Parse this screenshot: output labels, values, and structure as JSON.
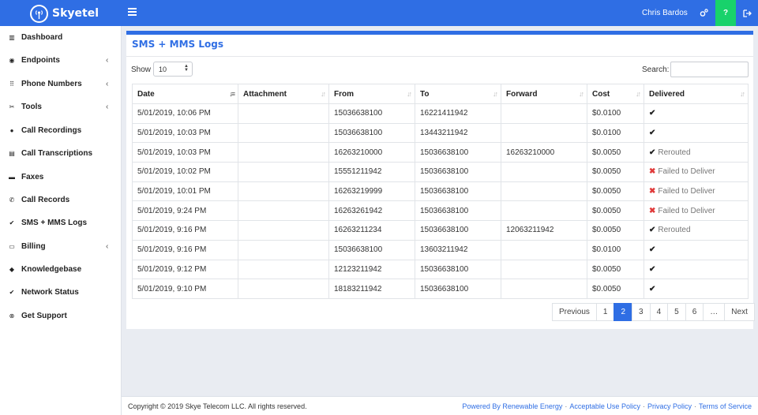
{
  "header": {
    "brand": "Skyetel",
    "user": "Chris Bardos",
    "help_label": "?"
  },
  "sidebar": {
    "items": [
      {
        "label": "Dashboard",
        "icon": "bar-chart-icon",
        "glyph": "▥",
        "chevron": ""
      },
      {
        "label": "Endpoints",
        "icon": "target-icon",
        "glyph": "◉",
        "chevron": "‹"
      },
      {
        "label": "Phone Numbers",
        "icon": "keypad-icon",
        "glyph": "⠿",
        "chevron": "‹"
      },
      {
        "label": "Tools",
        "icon": "tools-icon",
        "glyph": "✂",
        "chevron": "‹"
      },
      {
        "label": "Call Recordings",
        "icon": "microphone-icon",
        "glyph": "●",
        "chevron": ""
      },
      {
        "label": "Call Transcriptions",
        "icon": "document-icon",
        "glyph": "▤",
        "chevron": ""
      },
      {
        "label": "Faxes",
        "icon": "fax-icon",
        "glyph": "▬",
        "chevron": ""
      },
      {
        "label": "Call Records",
        "icon": "phone-icon",
        "glyph": "✆",
        "chevron": ""
      },
      {
        "label": "SMS + MMS Logs",
        "icon": "check-icon",
        "glyph": "✔",
        "chevron": ""
      },
      {
        "label": "Billing",
        "icon": "credit-card-icon",
        "glyph": "▭",
        "chevron": "‹"
      },
      {
        "label": "Knowledgebase",
        "icon": "graduation-cap-icon",
        "glyph": "◆",
        "chevron": ""
      },
      {
        "label": "Network Status",
        "icon": "check-circle-icon",
        "glyph": "✔",
        "chevron": ""
      },
      {
        "label": "Get Support",
        "icon": "lifebuoy-icon",
        "glyph": "⊗",
        "chevron": ""
      }
    ]
  },
  "main": {
    "title": "SMS + MMS Logs",
    "show_label": "Show",
    "show_value": "10",
    "search_label": "Search:",
    "search_placeholder": "",
    "columns": [
      "Date",
      "Attachment",
      "From",
      "To",
      "Forward",
      "Cost",
      "Delivered"
    ],
    "rows": [
      {
        "date": "5/01/2019, 10:06 PM",
        "attachment": "",
        "from": "15036638100",
        "to": "16221411942",
        "forward": "",
        "cost": "$0.0100",
        "status": "check",
        "delivered": ""
      },
      {
        "date": "5/01/2019, 10:03 PM",
        "attachment": "",
        "from": "15036638100",
        "to": "13443211942",
        "forward": "",
        "cost": "$0.0100",
        "status": "check",
        "delivered": ""
      },
      {
        "date": "5/01/2019, 10:03 PM",
        "attachment": "",
        "from": "16263210000",
        "to": "15036638100",
        "forward": "16263210000",
        "cost": "$0.0050",
        "status": "check",
        "delivered": "Rerouted"
      },
      {
        "date": "5/01/2019, 10:02 PM",
        "attachment": "",
        "from": "15551211942",
        "to": "15036638100",
        "forward": "",
        "cost": "$0.0050",
        "status": "x",
        "delivered": "Failed to Deliver"
      },
      {
        "date": "5/01/2019, 10:01 PM",
        "attachment": "",
        "from": "16263219999",
        "to": "15036638100",
        "forward": "",
        "cost": "$0.0050",
        "status": "x",
        "delivered": "Failed to Deliver"
      },
      {
        "date": "5/01/2019, 9:24 PM",
        "attachment": "",
        "from": "16263261942",
        "to": "15036638100",
        "forward": "",
        "cost": "$0.0050",
        "status": "x",
        "delivered": "Failed to Deliver"
      },
      {
        "date": "5/01/2019, 9:16 PM",
        "attachment": "",
        "from": "16263211234",
        "to": "15036638100",
        "forward": "12063211942",
        "cost": "$0.0050",
        "status": "check",
        "delivered": "Rerouted"
      },
      {
        "date": "5/01/2019, 9:16 PM",
        "attachment": "",
        "from": "15036638100",
        "to": "13603211942",
        "forward": "",
        "cost": "$0.0100",
        "status": "check",
        "delivered": ""
      },
      {
        "date": "5/01/2019, 9:12 PM",
        "attachment": "",
        "from": "12123211942",
        "to": "15036638100",
        "forward": "",
        "cost": "$0.0050",
        "status": "check",
        "delivered": ""
      },
      {
        "date": "5/01/2019, 9:10 PM",
        "attachment": "",
        "from": "18183211942",
        "to": "15036638100",
        "forward": "",
        "cost": "$0.0050",
        "status": "check",
        "delivered": ""
      }
    ],
    "pagination": {
      "previous": "Previous",
      "pages": [
        "1",
        "2",
        "3",
        "4",
        "5",
        "6",
        "…"
      ],
      "active": "2",
      "next": "Next"
    }
  },
  "footer": {
    "copyright": "Copyright © 2019 Skye Telecom LLC. All rights reserved.",
    "links": [
      "Powered By Renewable Energy",
      "Acceptable Use Policy",
      "Privacy Policy",
      "Terms of Service"
    ],
    "separator": "·"
  },
  "colors": {
    "accent": "#2f6ee4",
    "help_green": "#18d26b",
    "fail_red": "#e03a3a"
  }
}
